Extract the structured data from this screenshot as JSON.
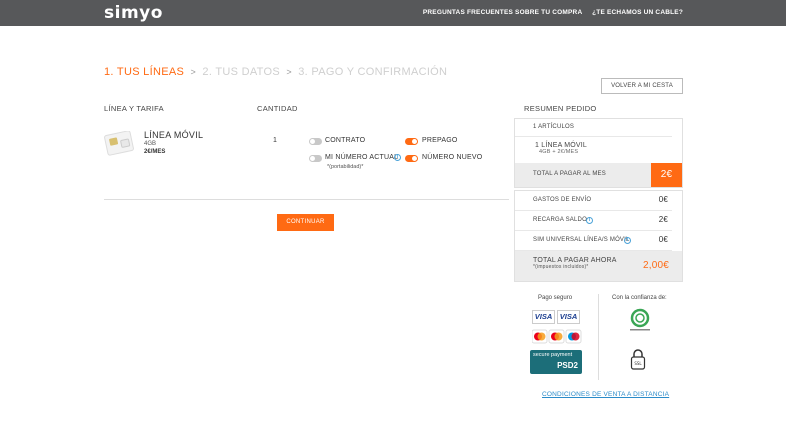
{
  "header": {
    "logo": "simyo",
    "links": [
      "PREGUNTAS FRECUENTES SOBRE TU COMPRA",
      "¿TE ECHAMOS UN CABLE?"
    ]
  },
  "steps": {
    "s1": "1. TUS LÍNEAS",
    "s2": "2. TUS DATOS",
    "s3": "3. PAGO Y CONFIRMACIÓN",
    "sep": ">"
  },
  "back_button": "VOLVER A MI CESTA",
  "columns": {
    "line": "LÍNEA Y TARIFA",
    "qty": "CANTIDAD",
    "summary": "RESUMEN PEDIDO"
  },
  "line_item": {
    "title": "LÍNEA MÓVIL",
    "data": "4GB",
    "price": "2€/MES",
    "quantity": "1"
  },
  "options": {
    "contrato": "CONTRATO",
    "prepago": "PREPAGO",
    "mi_numero": "MI NÚMERO ACTUAL",
    "portabilidad": "*(portabilidad)*",
    "numero_nuevo": "NÚMERO NUEVO",
    "info_glyph": "i"
  },
  "continue_button": "CONTINUAR",
  "summary": {
    "items_count": "1 ARTÍCULOS",
    "item_title": "1 LÍNEA MÓVIL",
    "item_sub": "4GB + 2€/MES",
    "monthly_label": "TOTAL A PAGAR AL MES",
    "monthly_value": "2€",
    "shipping_label": "GASTOS DE ENVÍO",
    "shipping_value": "0€",
    "recharge_label": "RECARGA SALDO",
    "recharge_value": "2€",
    "sim_label": "SIM UNIVERSAL LÍNEA/S MÓVIL",
    "sim_value": "0€",
    "total_label": "TOTAL A PAGAR AHORA",
    "total_sub": "*(impuestos incluidos)*",
    "total_value": "2,00€"
  },
  "trust": {
    "pago_seguro": "Pago seguro",
    "confianza": "Con la confianza de:",
    "visa": "VISA",
    "visa_electron": "VISA",
    "psd2_a": "secure payment",
    "psd2_b": "PSD2"
  },
  "conditions_link": "CONDICIONES DE VENTA A DISTANCIA",
  "colors": {
    "accent": "#ff6a13",
    "header": "#57585a",
    "link": "#2a8bc9"
  }
}
